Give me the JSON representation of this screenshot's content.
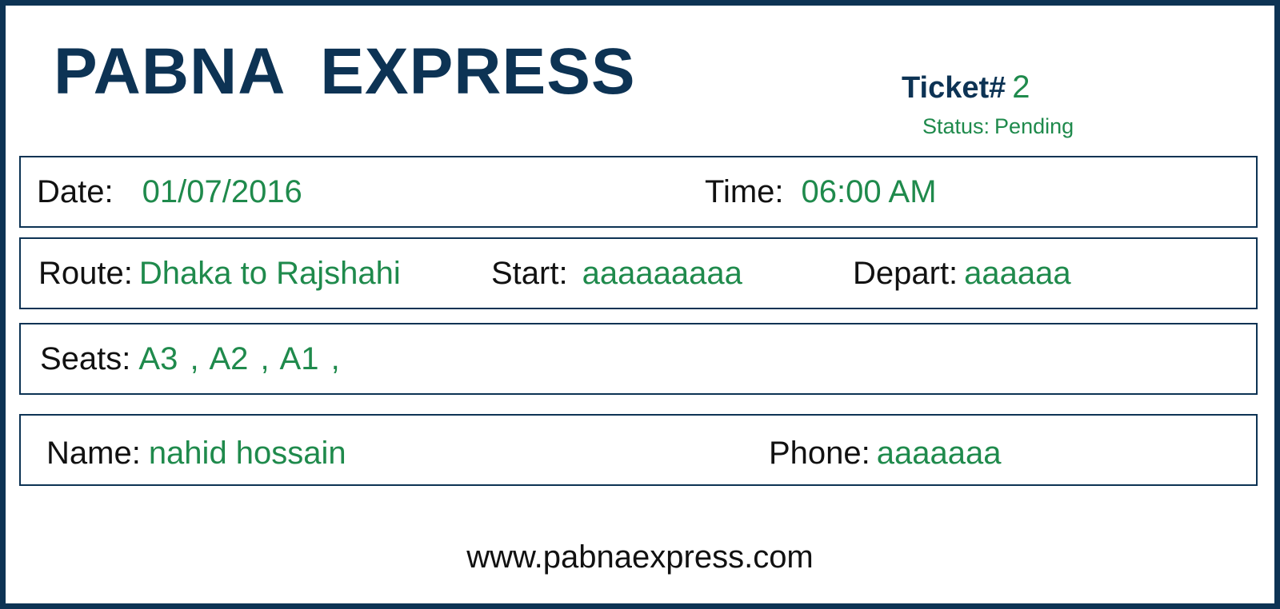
{
  "header": {
    "brand": "PABNA  EXPRESS",
    "ticket_label": "Ticket#",
    "ticket_number": "2",
    "status_label": "Status:",
    "status_value": "Pending"
  },
  "rows": {
    "date_label": "Date:",
    "date_value": "01/07/2016",
    "time_label": "Time:",
    "time_value": "06:00 AM",
    "route_label": "Route:",
    "route_value": "Dhaka to Rajshahi",
    "start_label": "Start:",
    "start_value": "aaaaaaaaa",
    "depart_label": "Depart:",
    "depart_value": "aaaaaa",
    "seats_label": "Seats:",
    "seats_value": "A3 , A2 , A1 ,",
    "name_label": "Name:",
    "name_value": "nahid hossain",
    "phone_label": "Phone:",
    "phone_value": "aaaaaaa"
  },
  "footer": {
    "website": "www.pabnaexpress.com"
  },
  "colors": {
    "brand_navy": "#0d3354",
    "value_green": "#1f8a4c",
    "label_black": "#111111"
  }
}
